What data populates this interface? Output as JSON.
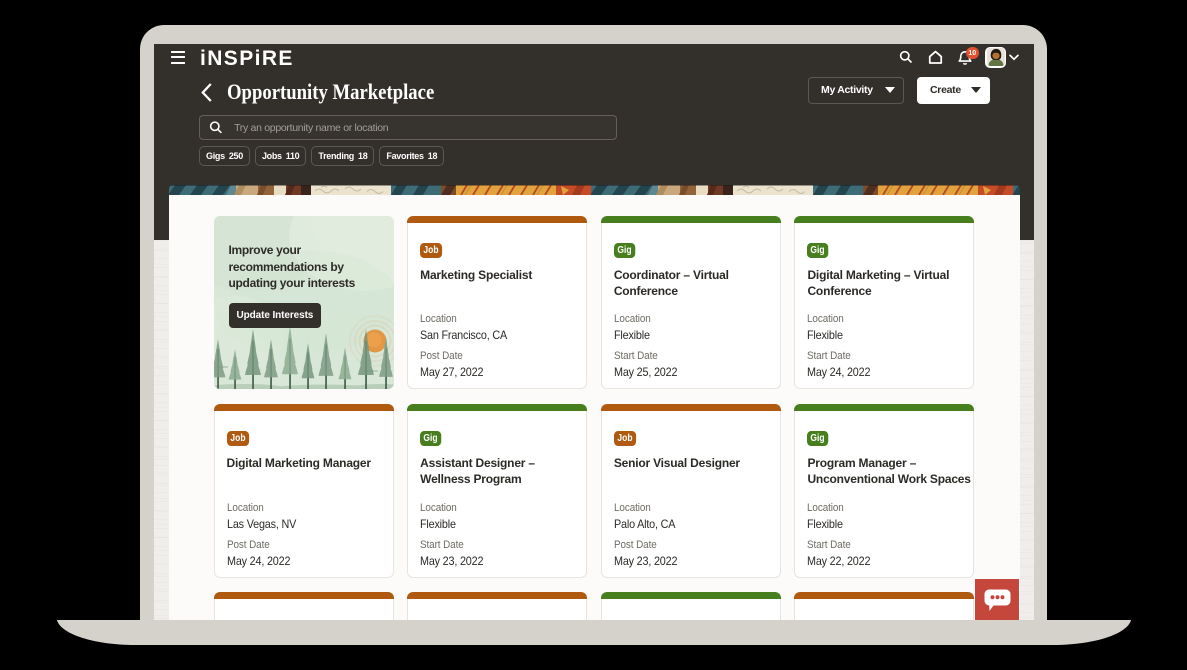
{
  "device": {
    "type": "laptop-mockup"
  },
  "topbar": {
    "logo": "iNSPiRE",
    "icons": [
      "menu",
      "search",
      "home",
      "notifications",
      "avatar",
      "expand"
    ],
    "notification_count": "10"
  },
  "header": {
    "title": "Opportunity Marketplace",
    "my_activity_label": "My Activity",
    "create_label": "Create"
  },
  "search": {
    "placeholder": "Try an opportunity name or location",
    "value": ""
  },
  "chips": [
    {
      "label": "Gigs",
      "count": "250"
    },
    {
      "label": "Jobs",
      "count": "110"
    },
    {
      "label": "Trending",
      "count": "18"
    },
    {
      "label": "Favorites",
      "count": "18"
    }
  ],
  "promo": {
    "text": "Improve your recommendations by updating your interests",
    "button_label": "Update Interests"
  },
  "cards": [
    {
      "type": "job",
      "badge": "Job",
      "title": "Marketing Specialist",
      "location_label": "Location",
      "location": "San Francisco, CA",
      "date_label": "Post Date",
      "date": "May 27, 2022"
    },
    {
      "type": "gig",
      "badge": "Gig",
      "title": "Coordinator – Virtual Conference",
      "location_label": "Location",
      "location": "Flexible",
      "date_label": "Start Date",
      "date": "May 25, 2022"
    },
    {
      "type": "gig",
      "badge": "Gig",
      "title": "Digital Marketing – Virtual Conference",
      "location_label": "Location",
      "location": "Flexible",
      "date_label": "Start Date",
      "date": "May 24, 2022"
    },
    {
      "type": "job",
      "badge": "Job",
      "title": "Digital Marketing Manager",
      "location_label": "Location",
      "location": "Las Vegas, NV",
      "date_label": "Post Date",
      "date": "May 24, 2022"
    },
    {
      "type": "gig",
      "badge": "Gig",
      "title": "Assistant Designer – Wellness Program",
      "location_label": "Location",
      "location": "Flexible",
      "date_label": "Start Date",
      "date": "May 23, 2022"
    },
    {
      "type": "job",
      "badge": "Job",
      "title": "Senior Visual Designer",
      "location_label": "Location",
      "location": "Palo Alto, CA",
      "date_label": "Post Date",
      "date": "May 23, 2022"
    },
    {
      "type": "gig",
      "badge": "Gig",
      "title": "Program Manager – Unconventional Work Spaces",
      "location_label": "Location",
      "location": "Flexible",
      "date_label": "Start Date",
      "date": "May 22, 2022"
    }
  ],
  "next_row_card_types": [
    "job",
    "job",
    "gig",
    "job"
  ],
  "theme": {
    "job_color": "#b05a10",
    "gig_color": "#477f1e",
    "header_bg": "#332f2b",
    "notification_badge_color": "#e04f35",
    "chat_button_color": "#c5463a"
  }
}
